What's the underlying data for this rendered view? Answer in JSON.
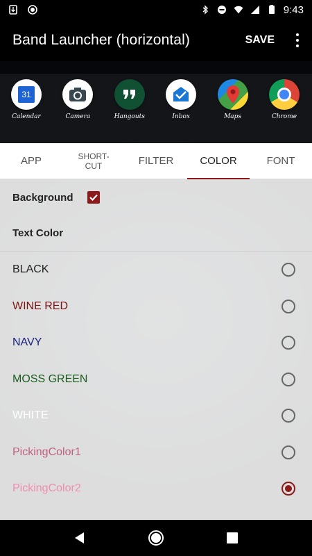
{
  "status_bar": {
    "time": "9:43"
  },
  "app_bar": {
    "title": "Band Launcher (horizontal)",
    "save_label": "SAVE"
  },
  "launcher": {
    "items": [
      {
        "label": "Calendar",
        "icon": "calendar-icon",
        "icon_text": "31"
      },
      {
        "label": "Camera",
        "icon": "camera-icon"
      },
      {
        "label": "Hangouts",
        "icon": "hangouts-icon"
      },
      {
        "label": "Inbox",
        "icon": "inbox-icon"
      },
      {
        "label": "Maps",
        "icon": "maps-icon"
      },
      {
        "label": "Chrome",
        "icon": "chrome-icon"
      }
    ]
  },
  "tabs": [
    {
      "label": "APP"
    },
    {
      "label": "SHORT-\nCUT"
    },
    {
      "label": "FILTER"
    },
    {
      "label": "COLOR",
      "active": true
    },
    {
      "label": "FONT"
    }
  ],
  "background": {
    "label": "Background",
    "checked": true
  },
  "text_color": {
    "title": "Text Color",
    "options": [
      {
        "label": "BLACK",
        "color": "#222222",
        "selected": false
      },
      {
        "label": "WINE RED",
        "color": "#7a1414",
        "selected": false
      },
      {
        "label": "NAVY",
        "color": "#1a237e",
        "selected": false
      },
      {
        "label": "MOSS GREEN",
        "color": "#1b5e20",
        "selected": false
      },
      {
        "label": "WHITE",
        "color": "#ffffff",
        "selected": false
      },
      {
        "label": "PickingColor1",
        "color": "#c06080",
        "selected": false
      },
      {
        "label": "PickingColor2",
        "color": "#f08cb0",
        "selected": true
      }
    ]
  },
  "colors": {
    "accent": "#8b1a1a"
  }
}
